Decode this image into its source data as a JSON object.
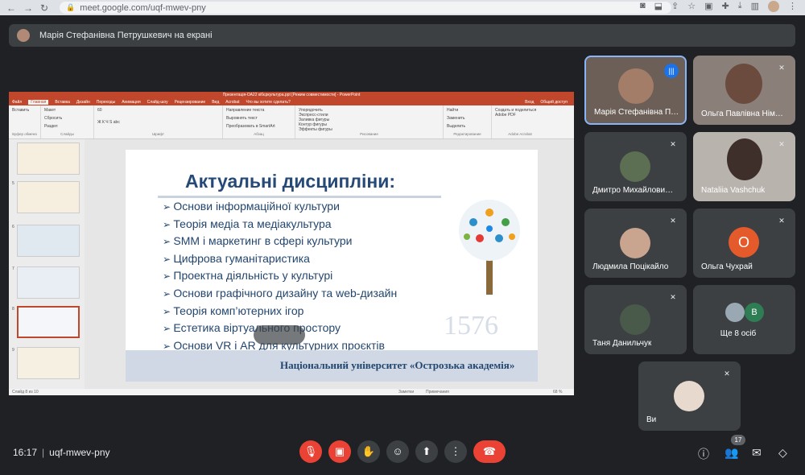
{
  "browser": {
    "url": "meet.google.com/uqf-mwev-pny",
    "back": "←",
    "forward": "→",
    "reload": "↻",
    "lock": "🔒"
  },
  "banner": {
    "text": "Марія Стефанівна Петрушкевич на екрані"
  },
  "powerpoint": {
    "window_title": "Презентація-ОА22 кібєркультура.ppt [Режим совместимости] - PowerPoint",
    "tabs": [
      "Файл",
      "Главная",
      "Вставка",
      "Дизайн",
      "Переходы",
      "Анимация",
      "Слайд-шоу",
      "Рецензирование",
      "Вид",
      "Acrobat",
      "Что вы хотите сделать?"
    ],
    "active_tab": "Главная",
    "login": "Вход",
    "share": "Общий доступ",
    "groups": [
      "Буфер обмена",
      "Слайды",
      "Шрифт",
      "Абзац",
      "Рисование",
      "Редактирование",
      "Adobe Acrobat"
    ],
    "ribbon_labels": {
      "paste": "Вставить",
      "new_slide": "Создать слайд",
      "layout": "Макет",
      "reset": "Сбросить",
      "section": "Раздел",
      "font_size": "60",
      "text_dir": "Направление текста",
      "align_text": "Выровнять текст",
      "smartart": "Преобразовать в SmartArt",
      "arrange": "Упорядочить",
      "quick_styles": "Экспресс-стили",
      "fill": "Заливка фигуры",
      "outline": "Контур фигуры",
      "effects": "Эффекты фигуры",
      "find": "Найти",
      "replace": "Заменить",
      "select": "Выделить",
      "acrobat": "Создать и поделиться Adobe PDF"
    },
    "thumbnail_numbers": [
      "5",
      "6",
      "7",
      "8",
      "9"
    ],
    "status_left": "Слайд 8 из 10",
    "status_right": [
      "Заметки",
      "Примечания",
      "68 %"
    ]
  },
  "slide": {
    "title": "Актуальні дисципліни:",
    "items": [
      "Основи інформаційної культури",
      "Теорія медіа та медіакультура",
      "SMM і маркетинг в сфері культури",
      "Цифрова гуманітаристика",
      "Проектна діяльність у культурі",
      "Основи графічного дизайну та web-дизайн",
      "Теорія комп’ютерних ігор",
      "Естетика віртуального простору",
      "Основи VR і AR для культурних проєктів"
    ],
    "footer": "Національний університет «Острозька академія»",
    "year": "1576"
  },
  "participants": [
    {
      "name": "Марія Стефанівна П…",
      "speaking": true,
      "video": true
    },
    {
      "name": "Ольга Павлівна Нім…",
      "muted": true,
      "video": true
    },
    {
      "name": "Дмитро Михайлови…",
      "muted": true,
      "video": false
    },
    {
      "name": "Nataliia Vashchuk",
      "muted": true,
      "video": true
    },
    {
      "name": "Людмила Поцікайло",
      "muted": true,
      "video": false
    },
    {
      "name": "Ольга Чухрай",
      "muted": true,
      "initial": "О"
    },
    {
      "name": "Таня Данильчук",
      "muted": true,
      "video": false
    },
    {
      "name": "Ще 8 осіб",
      "initial": "В"
    },
    {
      "name": "Ви",
      "muted": true
    }
  ],
  "bottom_bar": {
    "time": "16:17",
    "meeting_code": "uqf-mwev-pny",
    "people_count": "17"
  },
  "colors": {
    "background": "#202124",
    "tile": "#3c4043",
    "danger": "#ea4335",
    "accent": "#8ab4f8",
    "ppt_brand": "#c0472b"
  }
}
